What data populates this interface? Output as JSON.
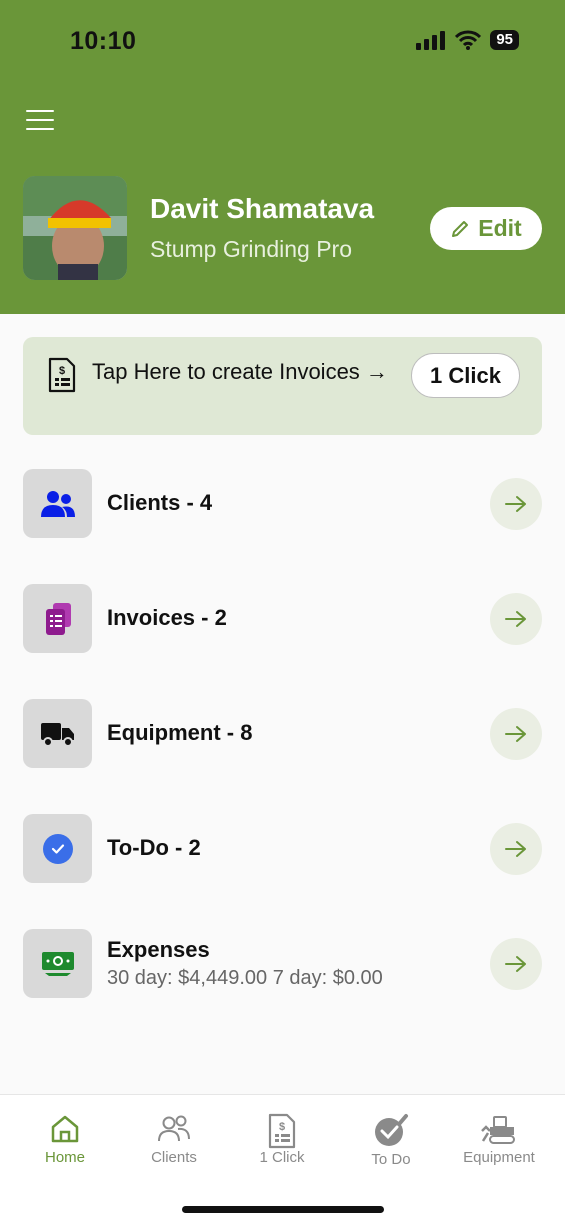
{
  "status_bar": {
    "time": "10:10",
    "battery": "95"
  },
  "profile": {
    "name": "Davit Shamatava",
    "subtitle": "Stump Grinding Pro",
    "edit_label": "Edit"
  },
  "banner": {
    "text": "Tap Here to create Invoices →",
    "button_label": "1 Click"
  },
  "menu": {
    "items": [
      {
        "label": "Clients - 4",
        "icon": "users-icon",
        "color": "#0a1fe6"
      },
      {
        "label": "Invoices - 2",
        "icon": "invoices-icon",
        "color": "#8e1b8e"
      },
      {
        "label": "Equipment - 8",
        "icon": "truck-icon",
        "color": "#111111"
      },
      {
        "label": "To-Do - 2",
        "icon": "check-circle-icon",
        "color": "#3a6ee8"
      },
      {
        "label": "Expenses",
        "sublabel": "30 day: $4,449.00 7 day: $0.00",
        "icon": "cash-icon",
        "color": "#1e8a2e"
      }
    ]
  },
  "tabbar": {
    "tabs": [
      {
        "label": "Home",
        "icon": "home-icon",
        "active": true
      },
      {
        "label": "Clients",
        "icon": "clients-icon",
        "active": false
      },
      {
        "label": "1 Click",
        "icon": "invoice-doc-icon",
        "active": false
      },
      {
        "label": "To Do",
        "icon": "todo-check-icon",
        "active": false
      },
      {
        "label": "Equipment",
        "icon": "bulldozer-icon",
        "active": false
      }
    ]
  },
  "colors": {
    "brand_green": "#6a9639",
    "banner_bg": "#dfe8d5"
  }
}
